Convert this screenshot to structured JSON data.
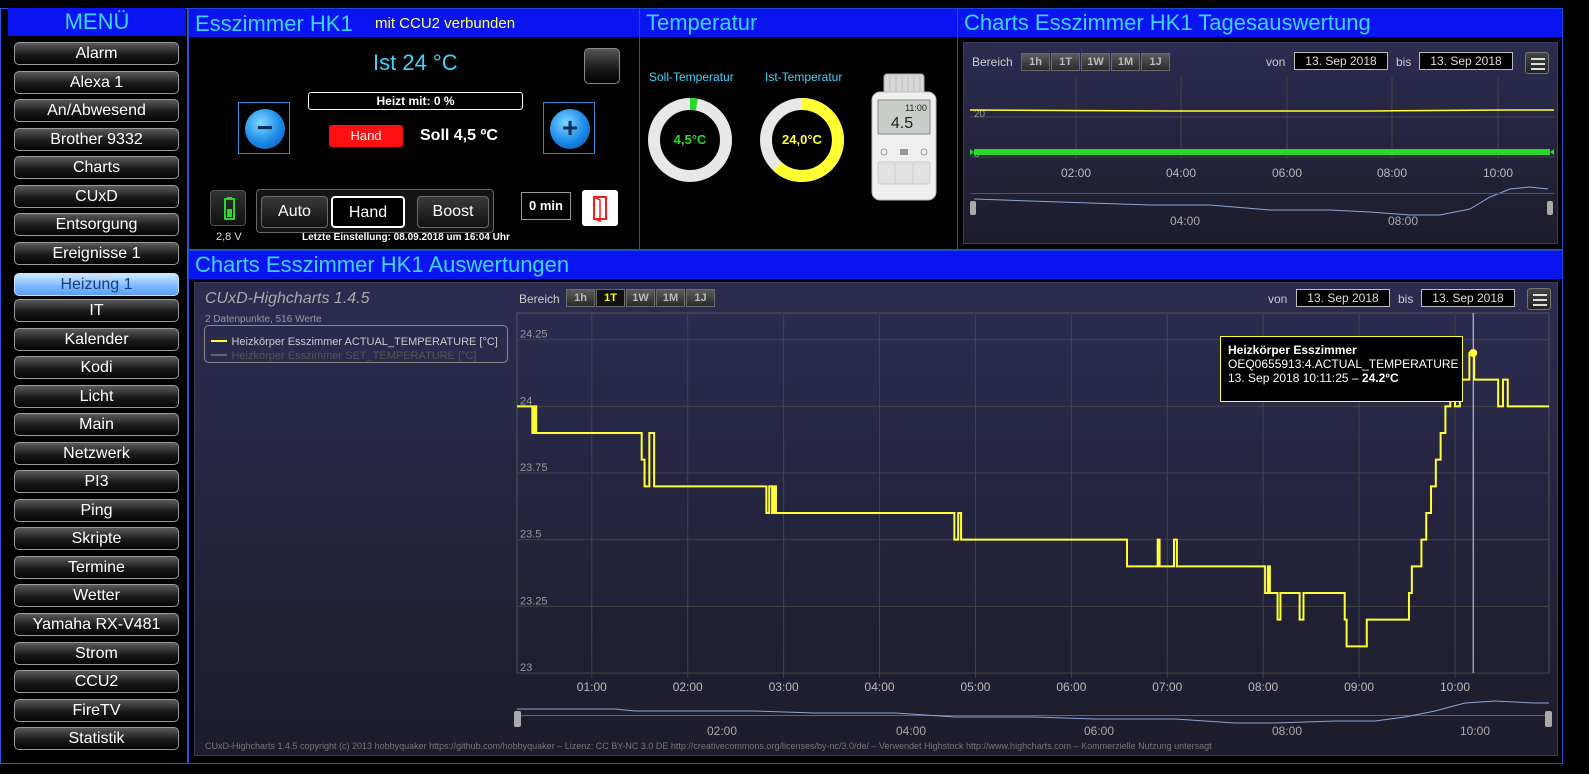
{
  "menu": {
    "title": "MENÜ",
    "items": [
      "Alarm",
      "Alexa 1",
      "An/Abwesend",
      "Brother 9332",
      "Charts",
      "CUxD",
      "Entsorgung",
      "Ereignisse 1",
      "Heizung 1",
      "IT",
      "Kalender",
      "Kodi",
      "Licht",
      "Main",
      "Netzwerk",
      "PI3",
      "Ping",
      "Skripte",
      "Termine",
      "Wetter",
      "Yamaha RX-V481",
      "Strom",
      "CCU2",
      "FireTV",
      "Statistik"
    ],
    "active": "Heizung 1"
  },
  "thermostat": {
    "title": "Esszimmer HK1",
    "connection": "mit CCU2 verbunden",
    "ist": "Ist 24 °C",
    "heizt": "Heizt mit: 0 %",
    "mode_badge": "Hand",
    "soll": "Soll 4,5 ºC",
    "minus_label": "−",
    "plus_label": "+",
    "battery": "2,8 V",
    "modes": [
      "Auto",
      "Hand",
      "Boost"
    ],
    "selected_mode": "Hand",
    "boost_min": "0 min",
    "last_setting": "Letzte Einstellung: 08.09.2018 um 16:04 Uhr"
  },
  "temperatur": {
    "title": "Temperatur",
    "soll_label": "Soll-Temperatur",
    "ist_label": "Ist-Temperatur",
    "soll_value": "4,5°C",
    "ist_value": "24,0°C",
    "soll_color": "#22dd22",
    "ist_color": "#ffff33",
    "soll_fraction": 0.03,
    "ist_fraction": 0.62,
    "device_display": "4.5",
    "device_time": "11:00"
  },
  "day_chart": {
    "title": "Charts Esszimmer HK1 Tagesauswertung",
    "bereich": "Bereich",
    "ranges": [
      "1h",
      "1T",
      "1W",
      "1M",
      "1J"
    ],
    "von_label": "von",
    "von": "13. Sep 2018",
    "bis_label": "bis",
    "bis": "13. Sep 2018",
    "y_ticks": [
      "20",
      "0"
    ],
    "x_ticks": [
      "02:00",
      "04:00",
      "06:00",
      "08:00",
      "10:00"
    ],
    "nav_ticks": [
      "04:00",
      "08:00"
    ]
  },
  "main_chart": {
    "title": "Charts Esszimmer HK1 Auswertungen",
    "highcharts_title": "CUxD-Highcharts 1.4.5",
    "subtitle": "2 Datenpunkte, 516 Werte",
    "legend": [
      "Heizkörper Esszimmer ACTUAL_TEMPERATURE [°C]",
      "Heizkörper Esszimmer SET_TEMPERATURE [°C]"
    ],
    "bereich": "Bereich",
    "ranges": [
      "1h",
      "1T",
      "1W",
      "1M",
      "1J"
    ],
    "selected_range": "1T",
    "von_label": "von",
    "von": "13. Sep 2018",
    "bis_label": "bis",
    "bis": "13. Sep 2018",
    "tooltip": {
      "title": "Heizkörper Esszimmer",
      "line2": "OEQ0655913:4.ACTUAL_TEMPERATURE",
      "line3": "13. Sep 2018 10:11:25 – ",
      "value": "24.2°C"
    },
    "nav_ticks": [
      "02:00",
      "04:00",
      "06:00",
      "08:00",
      "10:00"
    ],
    "footer": "CUxD-Highcharts 1.4.5 copyright (c) 2013 hobbyquaker https://github.com/hobbyquaker – Lizenz: CC BY-NC 3.0 DE http://creativecommons.org/licenses/by-nc/3.0/de/ – Verwendet Highstock http://www.highcharts.com – Kommerzielle Nutzung untersagt"
  },
  "chart_data": {
    "type": "line",
    "xlabel": "",
    "ylabel": "",
    "x_ticks": [
      "01:00",
      "02:00",
      "03:00",
      "04:00",
      "05:00",
      "06:00",
      "07:00",
      "08:00",
      "09:00",
      "10:00"
    ],
    "y_ticks": [
      23,
      23.25,
      23.5,
      23.75,
      24,
      24.25
    ],
    "ylim": [
      23,
      24.35
    ],
    "xlim": [
      0.22,
      10.98
    ],
    "series": [
      {
        "name": "Heizkörper Esszimmer ACTUAL_TEMPERATURE [°C]",
        "color": "#ffff33",
        "x": [
          0.22,
          0.35,
          0.38,
          0.4,
          0.42,
          0.45,
          1.5,
          1.52,
          1.55,
          1.6,
          1.65,
          1.7,
          1.72,
          2.8,
          2.82,
          2.85,
          2.88,
          2.9,
          2.92,
          2.95,
          4.75,
          4.78,
          4.82,
          4.85,
          6.55,
          6.58,
          6.62,
          6.88,
          6.9,
          6.92,
          6.95,
          7.05,
          7.07,
          7.1,
          7.12,
          8.0,
          8.02,
          8.05,
          8.07,
          8.1,
          8.15,
          8.18,
          8.2,
          8.38,
          8.4,
          8.42,
          8.8,
          8.85,
          8.87,
          8.9,
          9.05,
          9.08,
          9.1,
          9.5,
          9.52,
          9.55,
          9.6,
          9.65,
          9.7,
          9.75,
          9.8,
          9.85,
          9.9,
          9.95,
          10.0,
          10.05,
          10.1,
          10.15,
          10.2,
          10.25,
          10.3,
          10.4,
          10.45,
          10.5,
          10.55,
          10.6,
          10.65,
          10.98
        ],
        "y": [
          24.0,
          24.0,
          23.9,
          24.0,
          23.9,
          23.9,
          23.9,
          23.8,
          23.7,
          23.9,
          23.7,
          23.7,
          23.7,
          23.7,
          23.6,
          23.7,
          23.6,
          23.7,
          23.6,
          23.6,
          23.6,
          23.5,
          23.6,
          23.5,
          23.5,
          23.4,
          23.4,
          23.4,
          23.5,
          23.4,
          23.4,
          23.4,
          23.5,
          23.4,
          23.4,
          23.4,
          23.3,
          23.4,
          23.3,
          23.3,
          23.2,
          23.3,
          23.3,
          23.2,
          23.2,
          23.3,
          23.3,
          23.2,
          23.1,
          23.1,
          23.1,
          23.2,
          23.2,
          23.2,
          23.3,
          23.4,
          23.4,
          23.5,
          23.6,
          23.7,
          23.8,
          23.9,
          24.0,
          24.1,
          24.0,
          24.1,
          24.1,
          24.2,
          24.1,
          24.1,
          24.1,
          24.1,
          24.0,
          24.1,
          24.0,
          24.0,
          24.0,
          24.0
        ]
      }
    ],
    "highlight": {
      "x": 10.19,
      "y": 24.2
    },
    "grid": true,
    "legend_position": "top-left"
  }
}
